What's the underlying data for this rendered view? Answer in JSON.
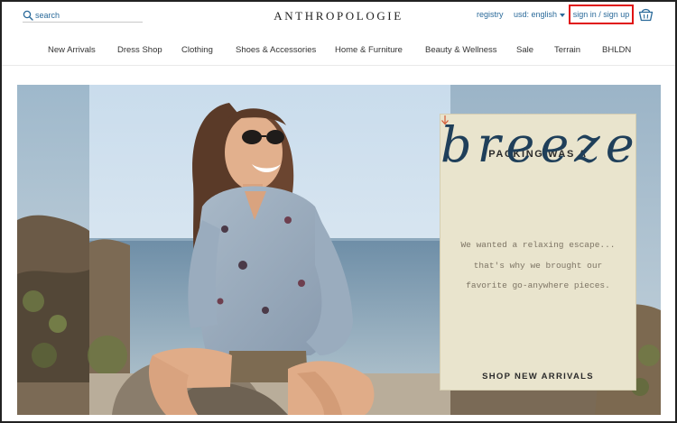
{
  "header": {
    "search": {
      "label": "search",
      "placeholder": "search"
    },
    "logo": "ANTHROPOLOGIE",
    "registry": "registry",
    "currency": "usd: english",
    "signin": "sign in / sign up"
  },
  "nav": {
    "items": [
      "New Arrivals",
      "Dress Shop",
      "Clothing",
      "Shoes & Accessories",
      "Home & Furniture",
      "Beauty & Wellness",
      "Sale",
      "Terrain",
      "BHLDN"
    ]
  },
  "hero": {
    "title": "PACKING WAS A",
    "script": "breeze",
    "body": [
      "We wanted a relaxing escape...",
      "that's why we brought our",
      "favorite go-anywhere pieces."
    ],
    "cta": "SHOP NEW ARRIVALS"
  },
  "colors": {
    "link": "#2a6a9a",
    "highlight": "#e01313",
    "card": "#e9e4cd",
    "script": "#1f3f5a",
    "arrow": "#d45a35"
  },
  "icons": {
    "search": "magnifier",
    "basket": "shopping-basket",
    "caret": "triangle-down",
    "arrow": "arrow-down"
  }
}
